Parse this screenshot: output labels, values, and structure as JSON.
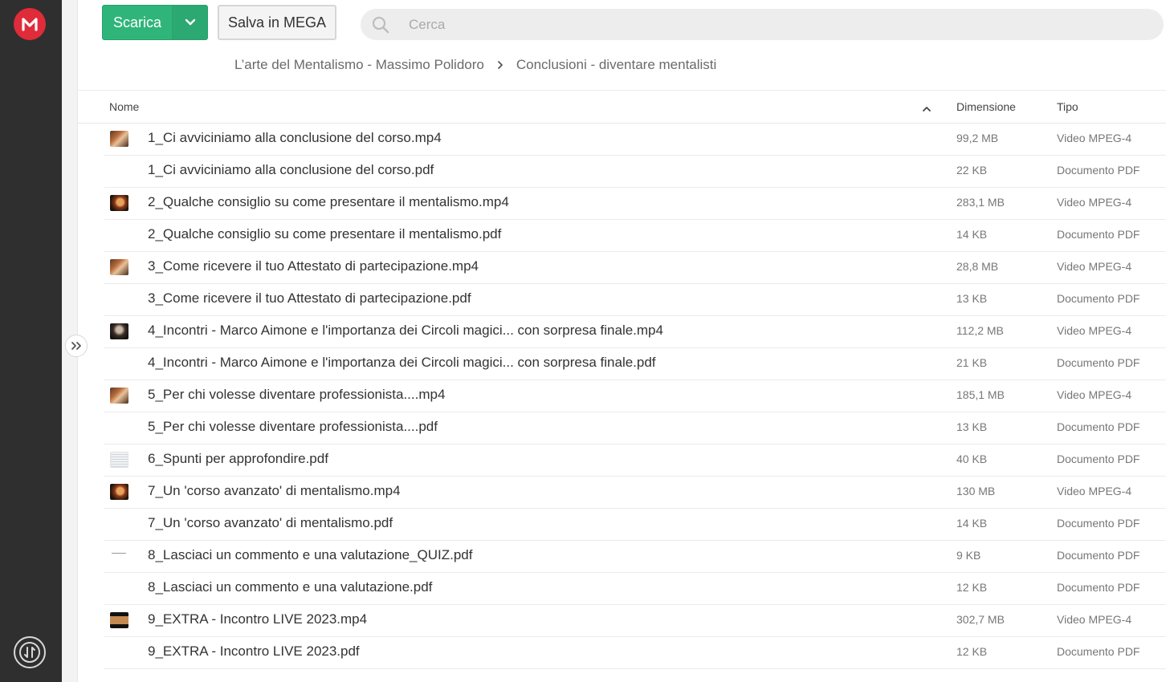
{
  "colors": {
    "brand": "#e02b3a",
    "download_green": "#2fb57a",
    "rail": "#2f2f2f"
  },
  "toolbar": {
    "download_label": "Scarica",
    "save_label": "Salva in MEGA"
  },
  "search": {
    "placeholder": "Cerca"
  },
  "breadcrumb": {
    "parent": "L’arte del Mentalismo - Massimo Polidoro",
    "current": "Conclusioni - diventare mentalisti"
  },
  "table": {
    "headers": {
      "name": "Nome",
      "size": "Dimensione",
      "type": "Tipo"
    },
    "rows": [
      {
        "name": "1_Ci avviciniamo alla conclusione del corso.mp4",
        "size": "99,2 MB",
        "type": "Video MPEG-4",
        "thumb": "video-thumb-1"
      },
      {
        "name": "1_Ci avviciniamo alla conclusione del corso.pdf",
        "size": "22 KB",
        "type": "Documento PDF",
        "thumb": "none"
      },
      {
        "name": "2_Qualche consiglio su come presentare il mentalismo.mp4",
        "size": "283,1 MB",
        "type": "Video MPEG-4",
        "thumb": "video-thumb-2"
      },
      {
        "name": "2_Qualche consiglio su come presentare il mentalismo.pdf",
        "size": "14 KB",
        "type": "Documento PDF",
        "thumb": "none"
      },
      {
        "name": "3_Come ricevere il tuo Attestato di partecipazione.mp4",
        "size": "28,8 MB",
        "type": "Video MPEG-4",
        "thumb": "video-thumb-1"
      },
      {
        "name": "3_Come ricevere il tuo Attestato di partecipazione.pdf",
        "size": "13 KB",
        "type": "Documento PDF",
        "thumb": "none"
      },
      {
        "name": "4_Incontri - Marco Aimone e l'importanza dei Circoli magici... con sorpresa finale.mp4",
        "size": "112,2 MB",
        "type": "Video MPEG-4",
        "thumb": "video-thumb-3"
      },
      {
        "name": "4_Incontri - Marco Aimone e l'importanza dei Circoli magici... con sorpresa finale.pdf",
        "size": "21 KB",
        "type": "Documento PDF",
        "thumb": "none"
      },
      {
        "name": "5_Per chi volesse diventare professionista....mp4",
        "size": "185,1 MB",
        "type": "Video MPEG-4",
        "thumb": "video-thumb-1"
      },
      {
        "name": "5_Per chi volesse diventare professionista....pdf",
        "size": "13 KB",
        "type": "Documento PDF",
        "thumb": "none"
      },
      {
        "name": "6_Spunti per approfondire.pdf",
        "size": "40 KB",
        "type": "Documento PDF",
        "thumb": "doc-thumb"
      },
      {
        "name": "7_Un 'corso avanzato' di mentalismo.mp4",
        "size": "130 MB",
        "type": "Video MPEG-4",
        "thumb": "video-thumb-2"
      },
      {
        "name": "7_Un 'corso avanzato' di mentalismo.pdf",
        "size": "14 KB",
        "type": "Documento PDF",
        "thumb": "none"
      },
      {
        "name": "8_Lasciaci un commento e una valutazione_QUIZ.pdf",
        "size": "9 KB",
        "type": "Documento PDF",
        "thumb": "line-thumb"
      },
      {
        "name": "8_Lasciaci un commento e una valutazione.pdf",
        "size": "12 KB",
        "type": "Documento PDF",
        "thumb": "none"
      },
      {
        "name": "9_EXTRA - Incontro LIVE 2023.mp4",
        "size": "302,7 MB",
        "type": "Video MPEG-4",
        "thumb": "video-thumb-4"
      },
      {
        "name": "9_EXTRA - Incontro LIVE 2023.pdf",
        "size": "12 KB",
        "type": "Documento PDF",
        "thumb": "none"
      }
    ]
  },
  "icons": {
    "logo": "mega-logo-icon",
    "transfer": "transfer-icon",
    "expand": "double-chevron-right-icon",
    "caret": "chevron-down-icon",
    "search": "search-icon",
    "breadcrumb_sep": "chevron-right-icon",
    "sort": "chevron-up-icon"
  }
}
